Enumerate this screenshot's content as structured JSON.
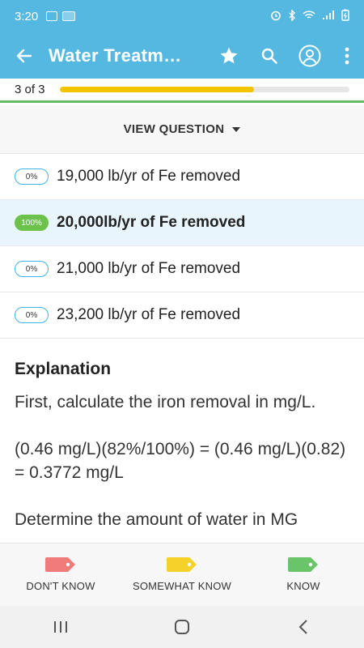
{
  "status": {
    "time": "3:20"
  },
  "app_bar": {
    "title": "Water Treatm…"
  },
  "progress": {
    "label": "3 of 3",
    "fraction": 0.67,
    "color": "#f3c500"
  },
  "view_question": {
    "label": "VIEW QUESTION"
  },
  "answers": [
    {
      "percent": "0%",
      "text": "19,000 lb/yr of Fe removed"
    },
    {
      "percent": "100%",
      "text": "20,000lb/yr of Fe removed"
    },
    {
      "percent": "0%",
      "text": "21,000 lb/yr of Fe removed"
    },
    {
      "percent": "0%",
      "text": "23,200 lb/yr of Fe removed"
    }
  ],
  "explanation": {
    "heading": "Explanation",
    "paragraphs": [
      "First, calculate the iron removal in mg/L.",
      "(0.46 mg/L)(82%/100%) = (0.46 mg/L)(0.82) = 0.3772 mg/L",
      "Determine the amount of water in MG"
    ]
  },
  "know_bar": {
    "dont_know": "DON'T KNOW",
    "somewhat_know": "SOMEWHAT KNOW",
    "know": "KNOW"
  },
  "colors": {
    "primary": "#55b8e0",
    "correct_badge": "#6cc24a",
    "dont_know_tag": "#f07b7b",
    "somewhat_tag": "#f5d22a",
    "know_tag": "#69c46a"
  }
}
